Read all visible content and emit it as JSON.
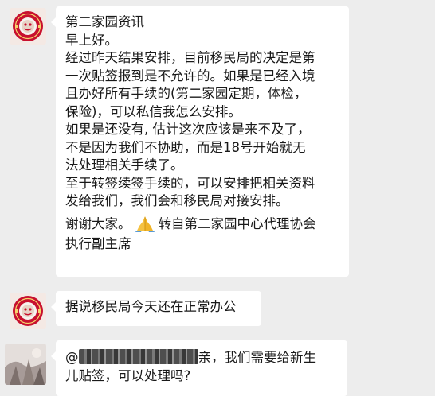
{
  "messages": [
    {
      "avatar": "red-seal-avatar",
      "lines": [
        "第二家园资讯",
        "早上好。",
        "经过昨天结果安排，目前移民局的决定是第",
        "一次贴签报到是不允许的。如果是已经入境",
        "且办好所有手续的(第二家园定期，体检，",
        "保险)，可以私信我怎么安排。",
        "如果是还没有, 估计这次应该是来不及了，",
        "不是因为我们不协助，而是18号开始就无",
        "法处理相关手续了。",
        "至于转签续签手续的，可以安排把相关资料",
        "发给我们，我们会和移民局对接安排。"
      ],
      "thanks_prefix": "谢谢大家。",
      "emoji": "folded-hands-emoji",
      "thanks_suffix": "转自第二家园中心代理协会",
      "last_line": "执行副主席"
    },
    {
      "avatar": "red-seal-avatar",
      "text": "据说移民局今天还在正常办公"
    },
    {
      "avatar": "blurred-photo-avatar",
      "mention_prefix": "@",
      "mention_suffix": "亲，我们需要给新生",
      "line2": "儿贴签，可以处理吗?"
    }
  ],
  "colors": {
    "background": "#ededed",
    "bubble": "#ffffff",
    "text": "#191919",
    "seal_red": "#c8102e"
  }
}
